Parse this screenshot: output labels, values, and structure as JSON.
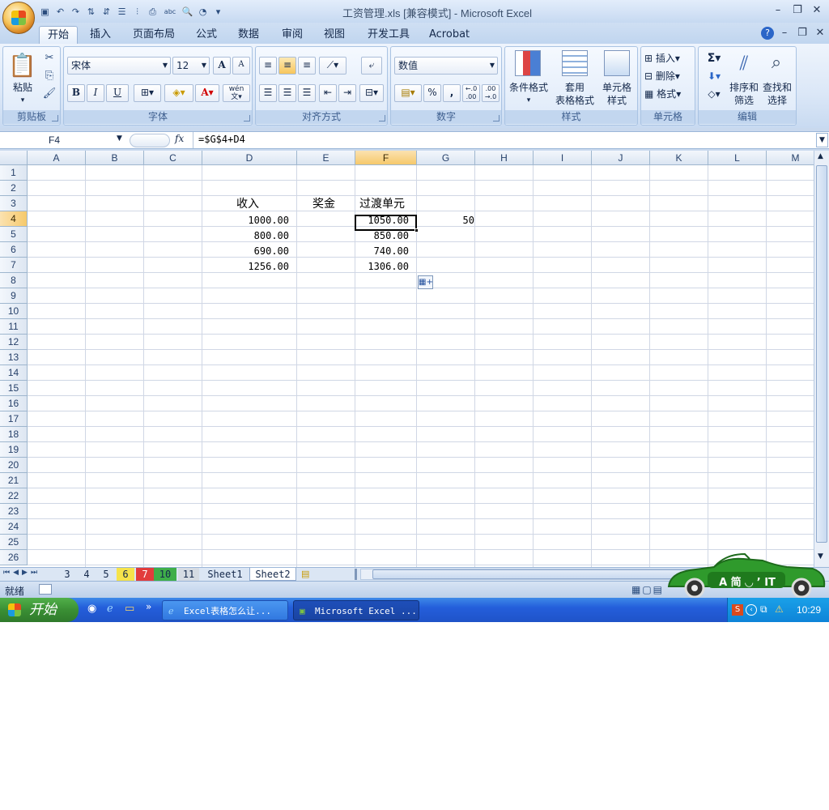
{
  "window": {
    "title": "工资管理.xls  [兼容模式] - Microsoft Excel"
  },
  "ribbon_tabs": [
    "开始",
    "插入",
    "页面布局",
    "公式",
    "数据",
    "审阅",
    "视图",
    "开发工具",
    "Acrobat"
  ],
  "clipboard": {
    "paste": "粘贴",
    "label": "剪贴板"
  },
  "font": {
    "name": "宋体",
    "size": "12",
    "label": "字体",
    "bold": "B",
    "italic": "I",
    "underline": "U",
    "grow": "A",
    "shrink": "A",
    "wen": "wén\n文"
  },
  "alignment": {
    "label": "对齐方式"
  },
  "number": {
    "format": "数值",
    "label": "数字",
    "percent": "%",
    "comma": ",",
    "inc": "+.0\n.00",
    "dec": ".00\n+.0"
  },
  "styles": {
    "conditional": "条件格式",
    "table_format_1": "套用",
    "table_format_2": "表格格式",
    "cell_style_1": "单元格",
    "cell_style_2": "样式",
    "label": "样式"
  },
  "cells": {
    "insert": "插入",
    "delete": "删除",
    "format": "格式",
    "label": "单元格"
  },
  "editing": {
    "sort_1": "排序和",
    "sort_2": "筛选",
    "find_1": "查找和",
    "find_2": "选择",
    "label": "编辑",
    "sigma": "Σ"
  },
  "formula_bar": {
    "name_box": "F4",
    "fx": "fx",
    "formula": "=$G$4+D4"
  },
  "columns": [
    "A",
    "B",
    "C",
    "D",
    "E",
    "F",
    "G",
    "H",
    "I",
    "J",
    "K",
    "L",
    "M"
  ],
  "rows": [
    "1",
    "2",
    "3",
    "4",
    "5",
    "6",
    "7",
    "8",
    "9",
    "10",
    "11",
    "12",
    "13",
    "14",
    "15",
    "16",
    "17",
    "18",
    "19",
    "20",
    "21",
    "22",
    "23",
    "24",
    "25",
    "26"
  ],
  "sheet": {
    "D3": "收入",
    "E3": "奖金",
    "F3": "过渡单元",
    "D4": "1000.00",
    "F4": "1050.00",
    "G4": "50",
    "D5": "800.00",
    "F5": "850.00",
    "D6": "690.00",
    "F6": "740.00",
    "D7": "1256.00",
    "F7": "1306.00"
  },
  "sheet_tabs": [
    "3",
    "4",
    "5",
    "6",
    "7",
    "10",
    "11",
    "Sheet1",
    "Sheet2"
  ],
  "status": {
    "ready": "就绪"
  },
  "taskbar": {
    "start": "开始",
    "tasks": [
      "Excel表格怎么让...",
      "Microsoft Excel ..."
    ],
    "clock": "10:29"
  },
  "car_text": "A 简 ◡ ’ IT",
  "colors": {
    "accent": "#245edb",
    "selected_header": "#f6c96b",
    "ribbon": "#dbe7f7"
  }
}
